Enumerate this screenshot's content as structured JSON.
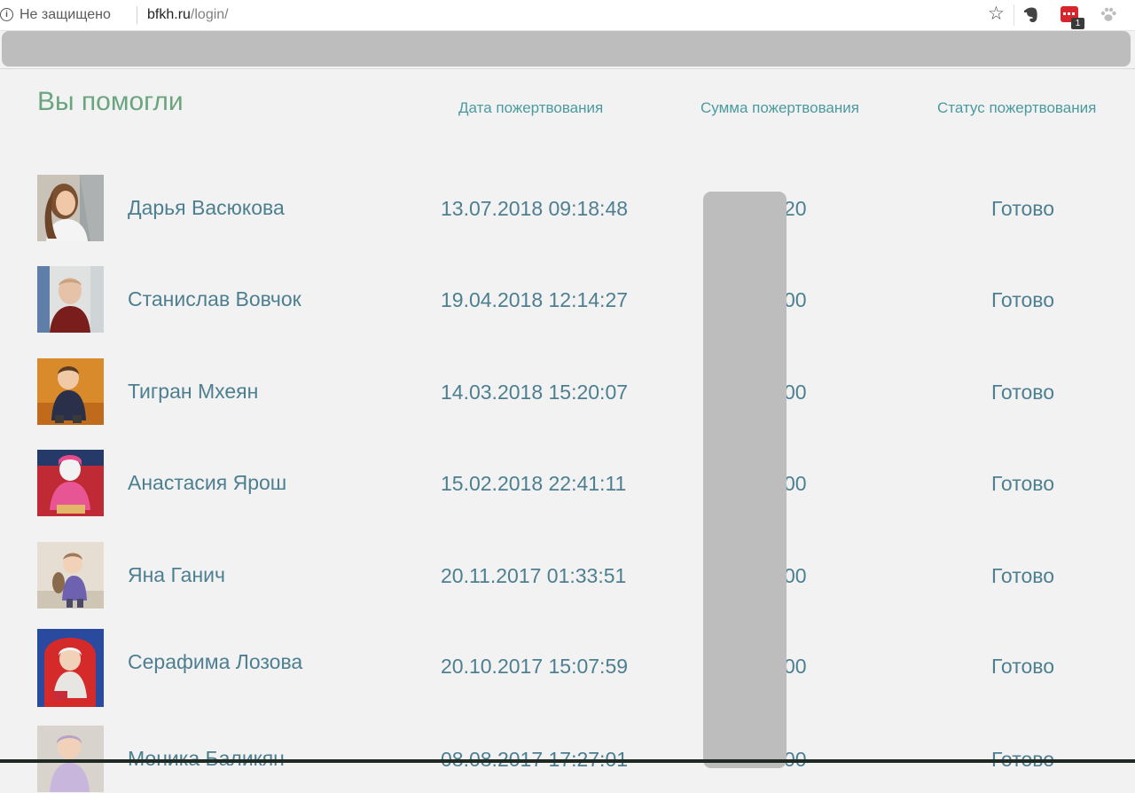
{
  "browser": {
    "security_text": "Не защищено",
    "url_host": "bfkh.ru",
    "url_path": "/login/",
    "extension_badge": "1"
  },
  "page": {
    "title": "Вы помогли",
    "columns": {
      "date": "Дата пожертвования",
      "amount": "Сумма пожертвования",
      "status": "Статус пожертвования"
    }
  },
  "donations": [
    {
      "name": "Дарья Васюкова",
      "date": "13.07.2018 09:18:48",
      "amount_visible": "20",
      "status": "Готово",
      "photo": "girl-photo"
    },
    {
      "name": "Станислав Вовчок",
      "date": "19.04.2018 12:14:27",
      "amount_visible": "00",
      "status": "Готово",
      "photo": "boy-photo"
    },
    {
      "name": "Тигран Мхеян",
      "date": "14.03.2018 15:20:07",
      "amount_visible": "00",
      "status": "Готово",
      "photo": "toddler-photo"
    },
    {
      "name": "Анастасия Ярош",
      "date": "15.02.2018 22:41:11",
      "amount_visible": "00",
      "status": "Готово",
      "photo": "child-pink-photo"
    },
    {
      "name": "Яна Ганич",
      "date": "20.11.2017 01:33:51",
      "amount_visible": "00",
      "status": "Готово",
      "photo": "toddler-toy-photo"
    },
    {
      "name": "Серафима Лозова",
      "date": "20.10.2017 15:07:59",
      "amount_visible": "00",
      "status": "Готово",
      "photo": "baby-chair-photo"
    },
    {
      "name": "Моника Баликян",
      "date": "08.08.2017 17:27:01",
      "amount_visible": "00",
      "status": "Готово",
      "photo": "baby-photo"
    }
  ],
  "colors": {
    "title_green": "#6aa57f",
    "header_teal": "#4b9aa0",
    "text_blue": "#4d7f91",
    "redaction_gray": "#bdbdbd"
  }
}
